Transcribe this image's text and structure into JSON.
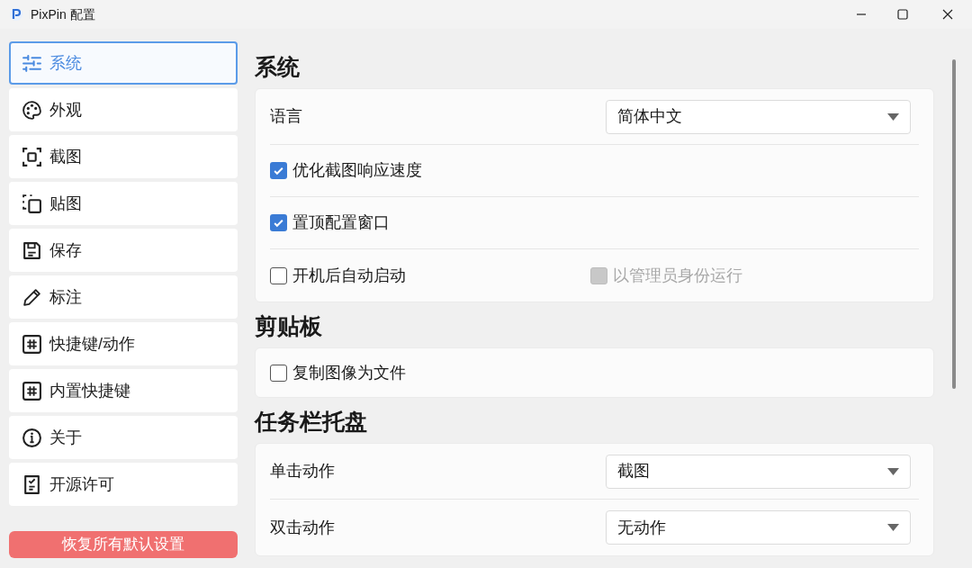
{
  "window": {
    "title": "PixPin 配置"
  },
  "sidebar": {
    "items": [
      {
        "label": "系统",
        "selected": true
      },
      {
        "label": "外观",
        "selected": false
      },
      {
        "label": "截图",
        "selected": false
      },
      {
        "label": "贴图",
        "selected": false
      },
      {
        "label": "保存",
        "selected": false
      },
      {
        "label": "标注",
        "selected": false
      },
      {
        "label": "快捷键/动作",
        "selected": false
      },
      {
        "label": "内置快捷键",
        "selected": false
      },
      {
        "label": "关于",
        "selected": false
      },
      {
        "label": "开源许可",
        "selected": false
      }
    ],
    "reset_button": "恢复所有默认设置"
  },
  "sections": [
    {
      "title": "系统",
      "rows": [
        {
          "kind": "select",
          "label": "语言",
          "value": "简体中文"
        },
        {
          "kind": "checkboxes",
          "items": [
            {
              "label": "优化截图响应速度",
              "checked": true,
              "disabled": false
            }
          ]
        },
        {
          "kind": "checkboxes",
          "items": [
            {
              "label": "置顶配置窗口",
              "checked": true,
              "disabled": false
            }
          ]
        },
        {
          "kind": "checkboxes",
          "items": [
            {
              "label": "开机后自动启动",
              "checked": false,
              "disabled": false
            },
            {
              "label": "以管理员身份运行",
              "checked": false,
              "disabled": true
            }
          ]
        }
      ]
    },
    {
      "title": "剪贴板",
      "rows": [
        {
          "kind": "checkboxes",
          "items": [
            {
              "label": "复制图像为文件",
              "checked": false,
              "disabled": false
            }
          ]
        }
      ]
    },
    {
      "title": "任务栏托盘",
      "rows": [
        {
          "kind": "select",
          "label": "单击动作",
          "value": "截图"
        },
        {
          "kind": "select",
          "label": "双击动作",
          "value": "无动作"
        }
      ]
    }
  ]
}
